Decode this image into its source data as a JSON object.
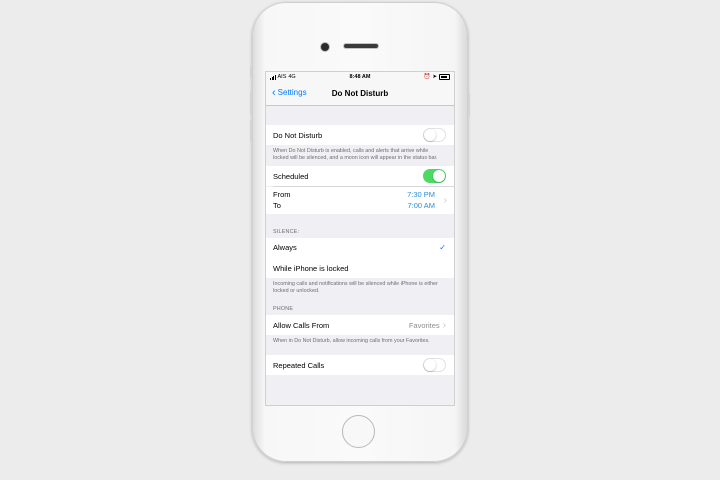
{
  "status_bar": {
    "carrier": "AIS",
    "network": "4G",
    "time": "8:48 AM"
  },
  "nav": {
    "back_label": "Settings",
    "title": "Do Not Disturb"
  },
  "dnd": {
    "label": "Do Not Disturb",
    "enabled": false,
    "note": "When Do Not Disturb is enabled, calls and alerts that arrive while locked will be silenced, and a moon icon will appear in the status bar."
  },
  "scheduled": {
    "label": "Scheduled",
    "enabled": true,
    "from_label": "From",
    "from_value": "7:30 PM",
    "to_label": "To",
    "to_value": "7:00 AM"
  },
  "silence": {
    "header": "SILENCE:",
    "options": [
      {
        "label": "Always",
        "selected": true
      },
      {
        "label": "While iPhone is locked",
        "selected": false
      }
    ],
    "note": "Incoming calls and notifications will be silenced while iPhone is either locked or unlocked."
  },
  "phone": {
    "header": "PHONE",
    "allow_calls_label": "Allow Calls From",
    "allow_calls_value": "Favorites",
    "note": "When in Do Not Disturb, allow incoming calls from your Favorites.",
    "repeated_calls_label": "Repeated Calls",
    "repeated_calls_enabled": false
  },
  "colors": {
    "accent": "#007aff",
    "toggle_on": "#4cd964",
    "time_value": "#2b8fd6"
  }
}
